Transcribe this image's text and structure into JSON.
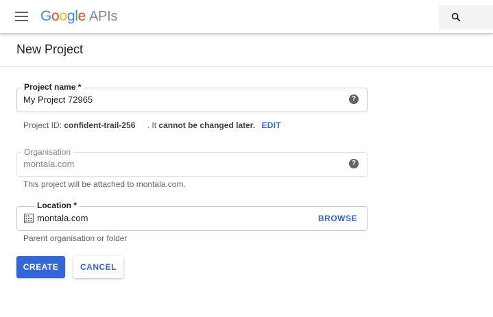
{
  "header": {
    "logo": {
      "letters": [
        {
          "ch": "G",
          "color": "#4285F4"
        },
        {
          "ch": "o",
          "color": "#EA4335"
        },
        {
          "ch": "o",
          "color": "#FBBC05"
        },
        {
          "ch": "g",
          "color": "#4285F4"
        },
        {
          "ch": "l",
          "color": "#34A853"
        },
        {
          "ch": "e",
          "color": "#EA4335"
        }
      ],
      "suffix": "APIs"
    },
    "menu_icon": "hamburger-menu-icon",
    "search_icon": "search-icon"
  },
  "page": {
    "title": "New Project"
  },
  "form": {
    "project_name": {
      "label": "Project name *",
      "value": "My Project 72965",
      "help_icon": "help-circle-icon"
    },
    "project_id": {
      "prefix": "Project ID:",
      "id": "confident-trail-256",
      "suffix_a": ". It",
      "suffix_b": "cannot be changed later.",
      "edit_label": "EDIT"
    },
    "organisation": {
      "label": "Organisation",
      "value": "montala.com",
      "help_icon": "help-circle-icon",
      "hint": "This project will be attached to montala.com."
    },
    "location": {
      "label": "Location *",
      "value": "montala.com",
      "icon": "building-icon",
      "browse_label": "BROWSE",
      "hint": "Parent organisation or folder"
    }
  },
  "actions": {
    "create_label": "CREATE",
    "cancel_label": "CANCEL"
  },
  "colors": {
    "accent": "#3367d6",
    "help_icon": "#5f6368"
  }
}
